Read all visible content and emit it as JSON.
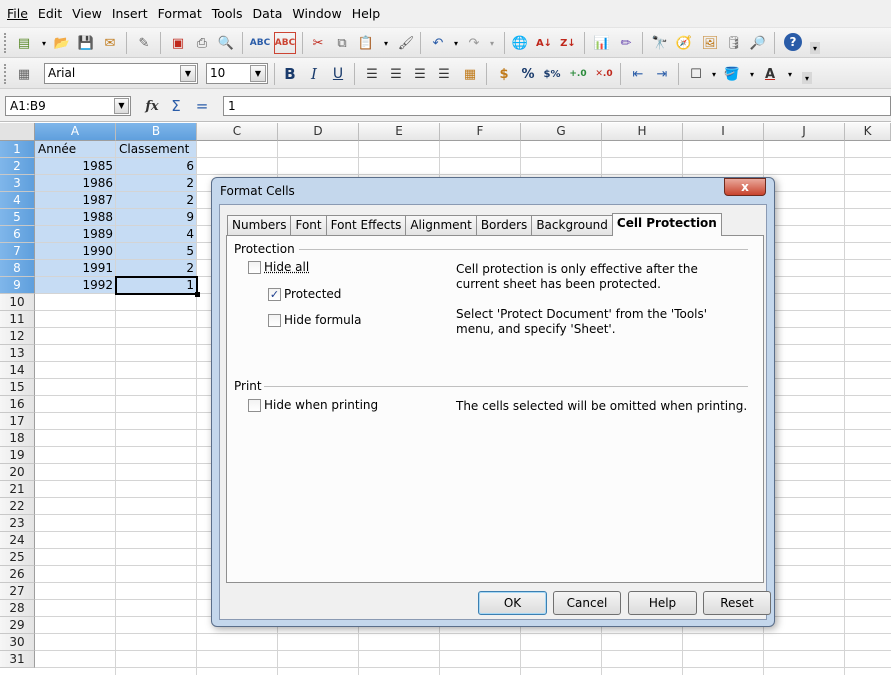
{
  "menu": [
    "File",
    "Edit",
    "View",
    "Insert",
    "Format",
    "Tools",
    "Data",
    "Window",
    "Help"
  ],
  "toolbar": {
    "font_name": "Arial",
    "font_size": "10",
    "bold": "B",
    "italic": "I",
    "underline": "U",
    "percent": "%"
  },
  "formula_bar": {
    "name_box": "A1:B9",
    "equals": "=",
    "content": "1"
  },
  "columns": [
    "A",
    "B",
    "C",
    "D",
    "E",
    "F",
    "G",
    "H",
    "I",
    "J",
    "K"
  ],
  "rows": [
    "1",
    "2",
    "3",
    "4",
    "5",
    "6",
    "7",
    "8",
    "9",
    "10",
    "11",
    "12",
    "13",
    "14",
    "15",
    "16",
    "17",
    "18",
    "19",
    "20",
    "21",
    "22",
    "23",
    "24",
    "25",
    "26",
    "27",
    "28",
    "29",
    "30",
    "31"
  ],
  "cells": {
    "A1": "Année",
    "B1": "Classement",
    "A": [
      "1985",
      "1986",
      "1987",
      "1988",
      "1989",
      "1990",
      "1991",
      "1992"
    ],
    "B": [
      "6",
      "2",
      "2",
      "9",
      "4",
      "5",
      "2",
      "1"
    ]
  },
  "dialog": {
    "title": "Format Cells",
    "close": "x",
    "tabs": [
      "Numbers",
      "Font",
      "Font Effects",
      "Alignment",
      "Borders",
      "Background",
      "Cell Protection"
    ],
    "active_tab": "Cell Protection",
    "protection_label": "Protection",
    "hide_all": {
      "label": "Hide all",
      "checked": false
    },
    "protected": {
      "label": "Protected",
      "checked": true
    },
    "hide_formula": {
      "label": "Hide formula",
      "checked": false
    },
    "hint1": "Cell protection is only effective after the current sheet has been protected.",
    "hint2": "Select 'Protect Document' from the 'Tools' menu, and specify 'Sheet'.",
    "print_label": "Print",
    "hide_printing": {
      "label": "Hide when printing",
      "checked": false
    },
    "hint3": "The cells selected will be omitted when printing.",
    "buttons": {
      "ok": "OK",
      "cancel": "Cancel",
      "help": "Help",
      "reset": "Reset"
    }
  },
  "colors": {
    "selection": "#c6dcf4",
    "header_selected": "#6ba8e3",
    "dialog_frame": "#c4d7ec"
  }
}
